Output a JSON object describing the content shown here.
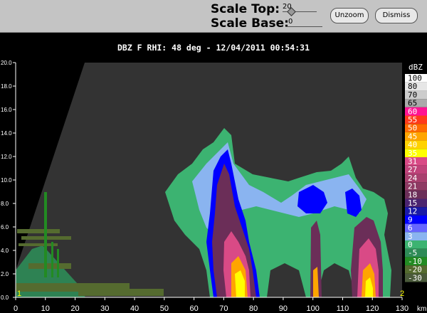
{
  "toolbar": {
    "scale_top_label": "Scale Top:",
    "scale_top_value": "20",
    "scale_base_label": "Scale Base:",
    "scale_base_value": "0",
    "unzoom_label": "Unzoom",
    "dismiss_label": "Dismiss"
  },
  "title": "DBZ F  RHI: 48 deg  -  12/04/2011 00:54:31",
  "legend": {
    "unit": "dBZ",
    "entries": [
      {
        "label": "100",
        "color": "#ffffff"
      },
      {
        "label": "80",
        "color": "#e6e6e6"
      },
      {
        "label": "70",
        "color": "#cccccc"
      },
      {
        "label": "65",
        "color": "#aaaaaa"
      },
      {
        "label": "60",
        "color": "#ff1493"
      },
      {
        "label": "55",
        "color": "#ff3a1a"
      },
      {
        "label": "50",
        "color": "#ff6a00"
      },
      {
        "label": "45",
        "color": "#ffa500"
      },
      {
        "label": "40",
        "color": "#ffd200"
      },
      {
        "label": "35",
        "color": "#ffff00"
      },
      {
        "label": "31",
        "color": "#d94a86"
      },
      {
        "label": "27",
        "color": "#c0437a"
      },
      {
        "label": "24",
        "color": "#a8406e"
      },
      {
        "label": "21",
        "color": "#8e3a63"
      },
      {
        "label": "18",
        "color": "#6b2e58"
      },
      {
        "label": "15",
        "color": "#4b2470"
      },
      {
        "label": "12",
        "color": "#1a1aa8"
      },
      {
        "label": "9",
        "color": "#0000ff"
      },
      {
        "label": "6",
        "color": "#6666ff"
      },
      {
        "label": "3",
        "color": "#8ab4f0"
      },
      {
        "label": "0",
        "color": "#3cb371"
      },
      {
        "label": "-5",
        "color": "#2e8b57"
      },
      {
        "label": "-10",
        "color": "#228b22"
      },
      {
        "label": "-20",
        "color": "#556b2f"
      },
      {
        "label": "-30",
        "color": "#4a5a3a"
      }
    ]
  },
  "x_axis": {
    "ticks": [
      "0",
      "10",
      "20",
      "30",
      "40",
      "50",
      "60",
      "70",
      "80",
      "90",
      "100",
      "110",
      "120",
      "130"
    ],
    "unit": "km"
  },
  "y_axis": {
    "ticks": [
      "0.0",
      "2.0",
      "4.0",
      "6.0",
      "8.0",
      "10.0",
      "12.0",
      "14.0",
      "16.0",
      "18.0",
      "20.0"
    ]
  },
  "markers": [
    "1",
    "2"
  ],
  "colors": {
    "background": "#000000",
    "plot_bg": "#333333",
    "toolbar_bg": "#c4c4c4"
  }
}
